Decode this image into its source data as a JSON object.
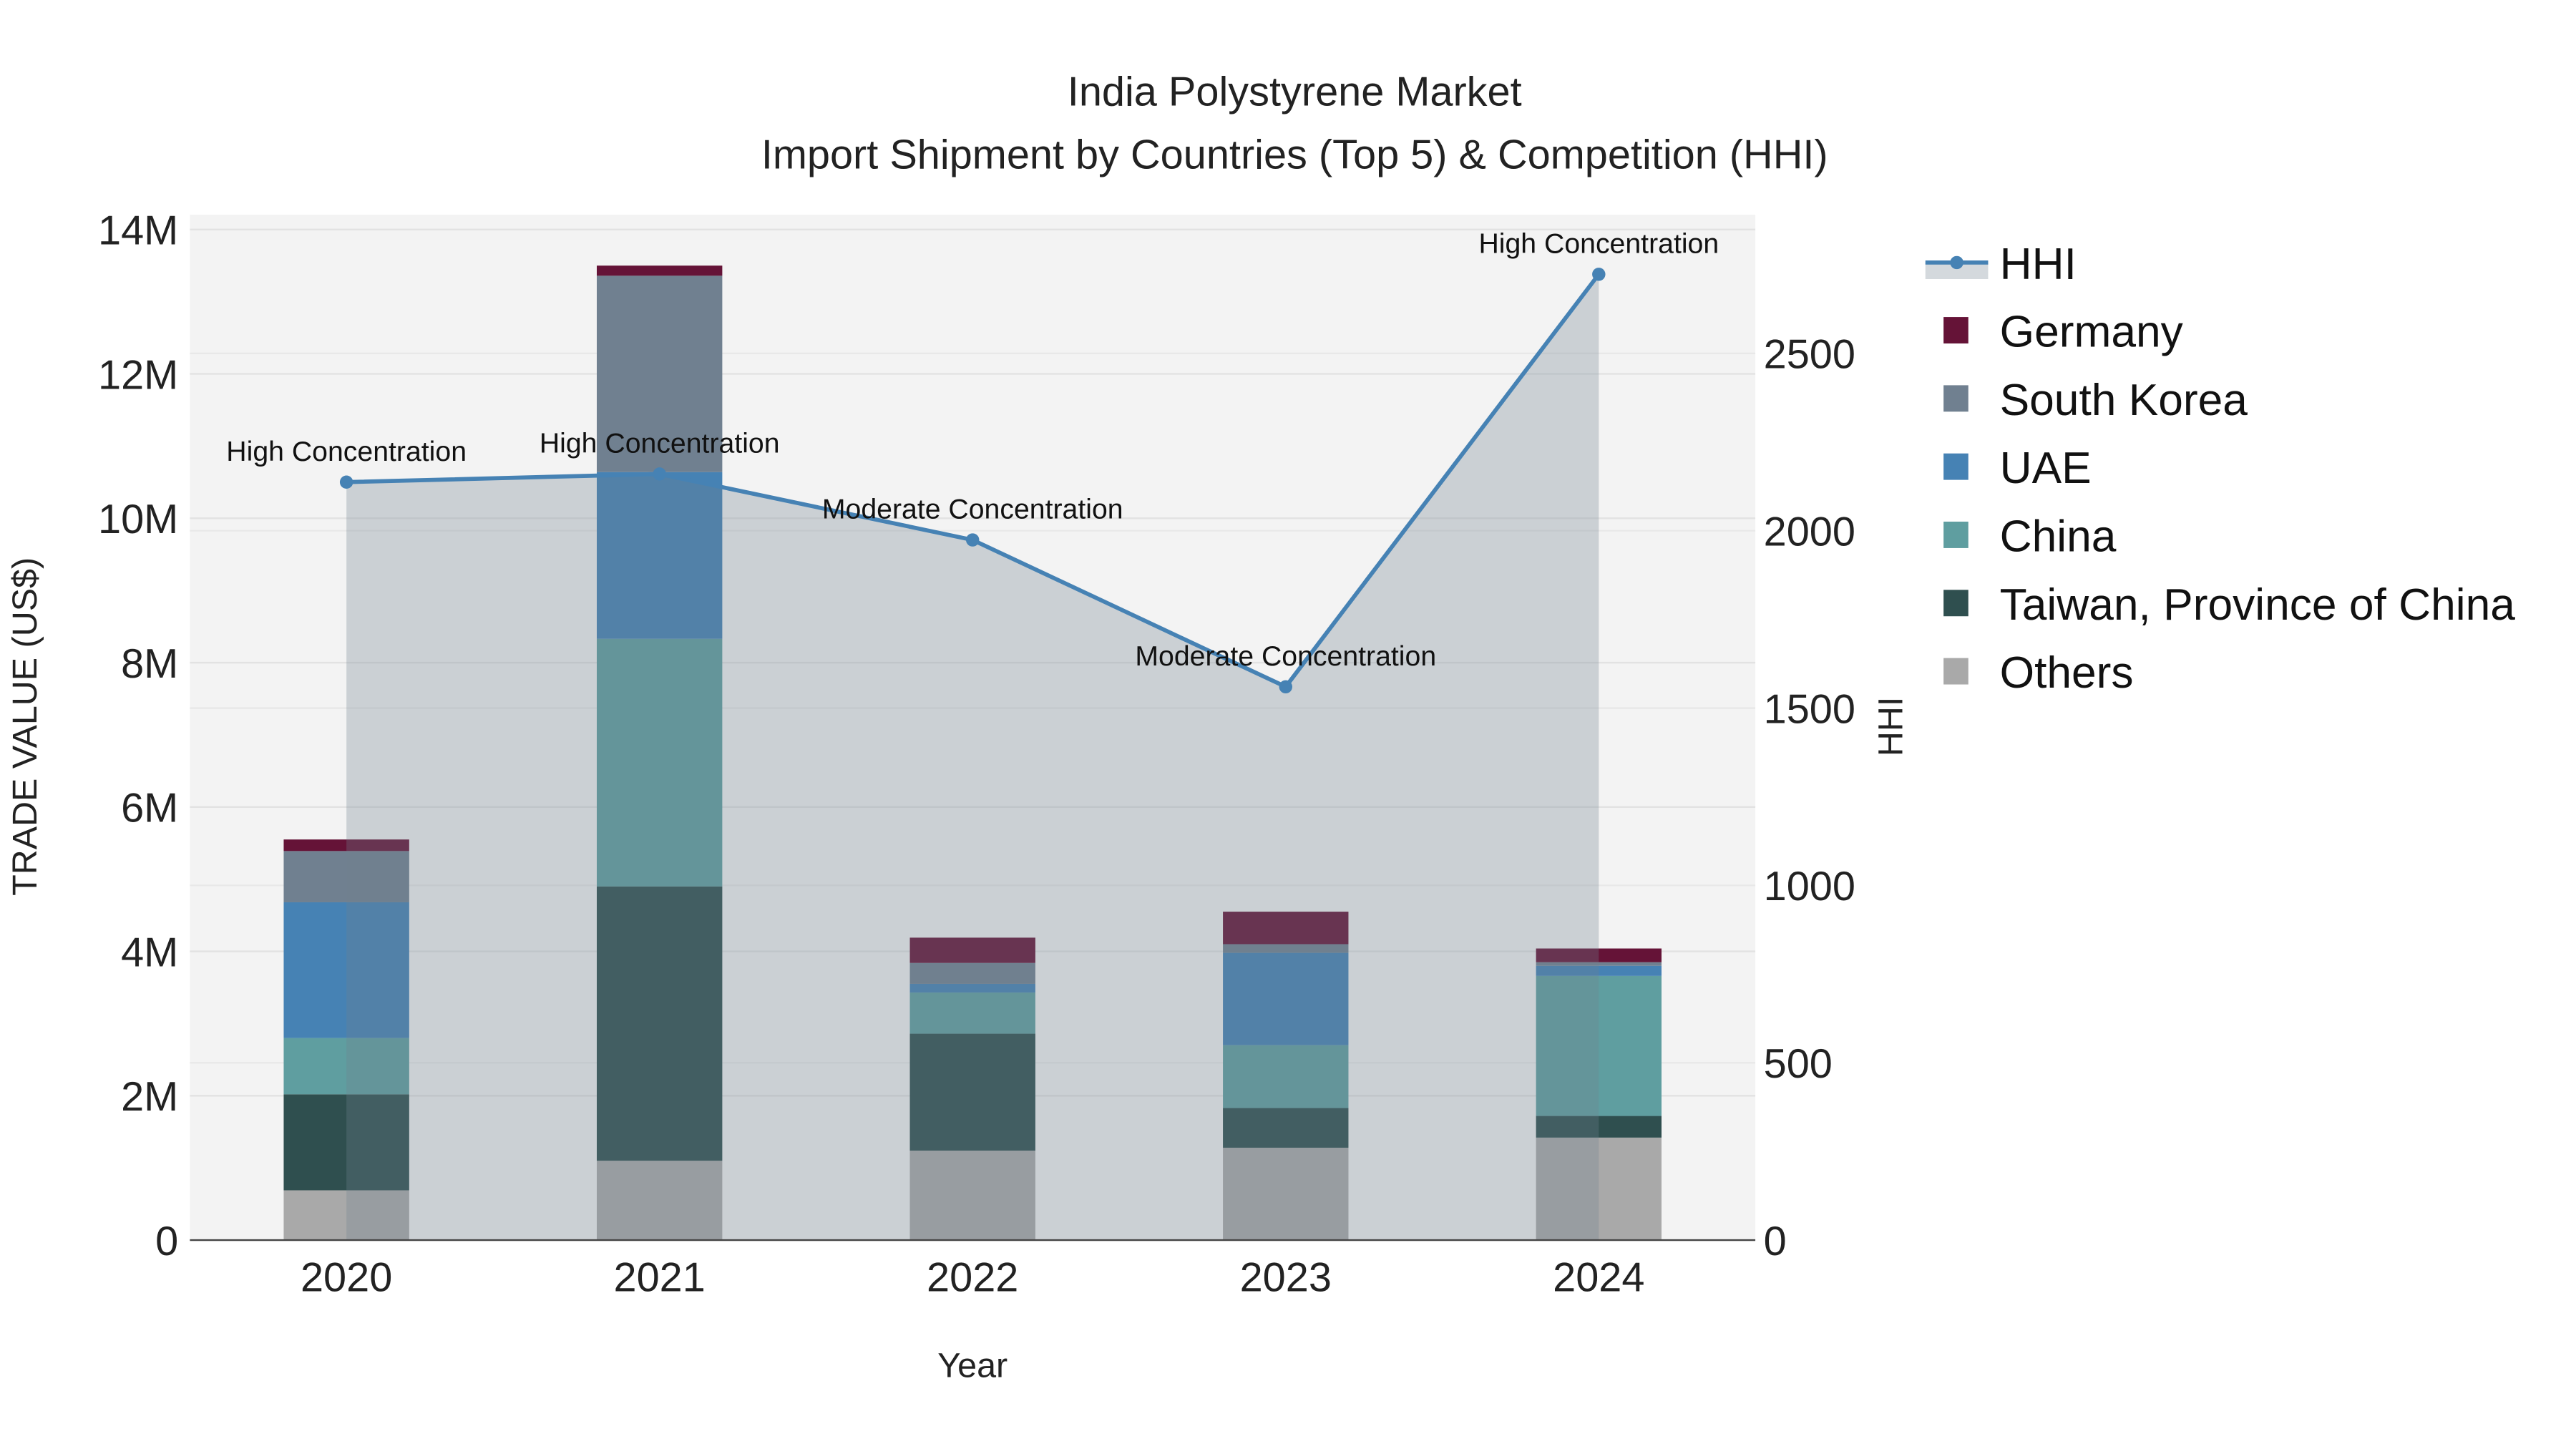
{
  "chart_data": {
    "type": "bar",
    "title": "India Polystyrene Market",
    "subtitle": "Import Shipment by Countries (Top 5) & Competition (HHI)",
    "xlabel": "Year",
    "ylabel": "TRADE VALUE (US$)",
    "y2label": "HHI",
    "categories": [
      "2020",
      "2021",
      "2022",
      "2023",
      "2024"
    ],
    "ylim": [
      0,
      14000000
    ],
    "y_ticks": [
      0,
      2000000,
      4000000,
      6000000,
      8000000,
      10000000,
      12000000,
      14000000
    ],
    "y_tick_labels": [
      "0",
      "2M",
      "4M",
      "6M",
      "8M",
      "10M",
      "12M",
      "14M"
    ],
    "y2lim": [
      0,
      2850
    ],
    "y2_ticks": [
      0,
      500,
      1000,
      1500,
      2000,
      2500
    ],
    "y2_tick_labels": [
      "0",
      "500",
      "1000",
      "1500",
      "2000",
      "2500"
    ],
    "stacked": true,
    "grid": true,
    "legend_position": "right",
    "series": [
      {
        "name": "Others",
        "color": "#a9a9a9",
        "values": [
          690000,
          1100000,
          1240000,
          1280000,
          1420000
        ]
      },
      {
        "name": "Taiwan, Province of China",
        "color": "#2f4f4f",
        "values": [
          1330000,
          3800000,
          1620000,
          550000,
          300000
        ]
      },
      {
        "name": "China",
        "color": "#5f9ea0",
        "values": [
          780000,
          3430000,
          570000,
          870000,
          1940000
        ]
      },
      {
        "name": "UAE",
        "color": "#4682b4",
        "values": [
          1880000,
          2310000,
          120000,
          1280000,
          140000
        ]
      },
      {
        "name": "South Korea",
        "color": "#708090",
        "values": [
          710000,
          2720000,
          290000,
          120000,
          50000
        ]
      },
      {
        "name": "Germany",
        "color": "#651337",
        "values": [
          160000,
          140000,
          350000,
          450000,
          190000
        ]
      }
    ],
    "line": {
      "name": "HHI",
      "color": "#4682b4",
      "axis": "right",
      "values": [
        2137,
        2160,
        1974,
        1560,
        2723
      ],
      "annotations": [
        "High Concentration",
        "High Concentration",
        "Moderate Concentration",
        "Moderate Concentration",
        "High Concentration"
      ]
    },
    "legend": [
      "HHI",
      "Germany",
      "South Korea",
      "UAE",
      "China",
      "Taiwan, Province of China",
      "Others"
    ]
  }
}
